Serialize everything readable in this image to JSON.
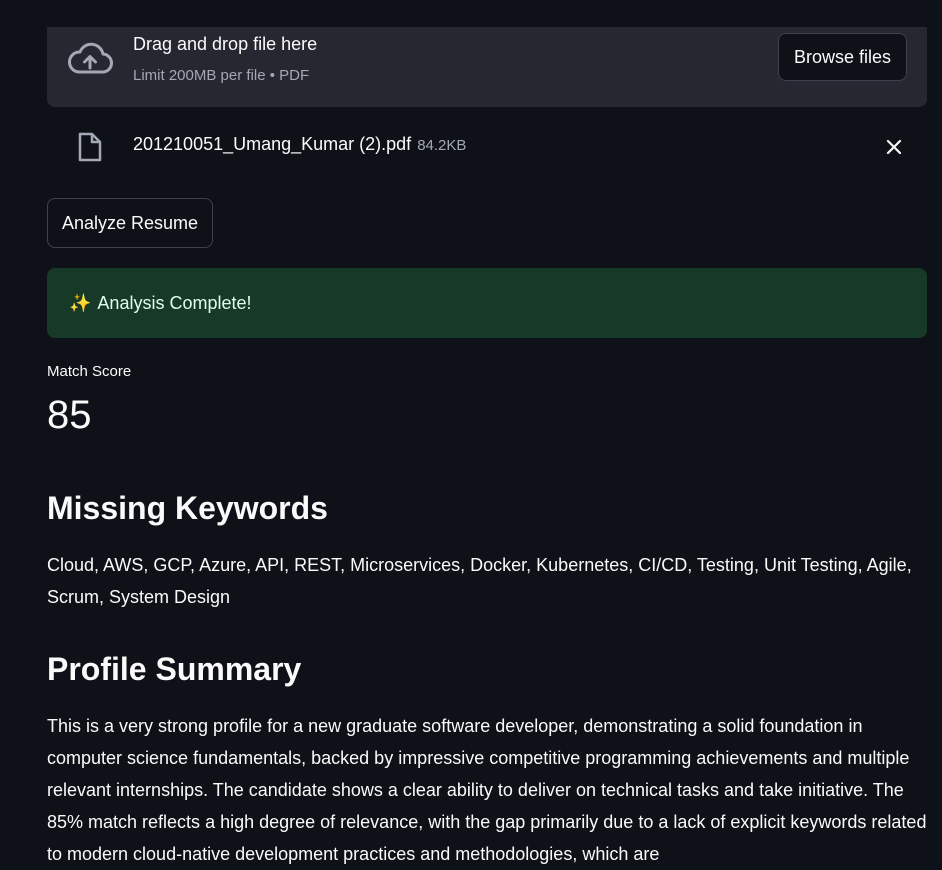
{
  "uploader": {
    "icon": "cloud-upload-icon",
    "title": "Drag and drop file here",
    "subtitle": "Limit 200MB per file • PDF",
    "browse_label": "Browse files"
  },
  "uploaded_file": {
    "icon": "file-icon",
    "name": "201210051_Umang_Kumar (2).pdf",
    "size": "84.2KB",
    "remove_icon": "close-icon"
  },
  "actions": {
    "analyze_label": "Analyze Resume"
  },
  "status": {
    "icon": "sparkles-icon",
    "icon_glyph": "✨",
    "message": "Analysis Complete!",
    "color": "#173928"
  },
  "metric": {
    "label": "Match Score",
    "value": "85"
  },
  "missing_keywords": {
    "heading": "Missing Keywords",
    "text": "Cloud, AWS, GCP, Azure, API, REST, Microservices, Docker, Kubernetes, CI/CD, Testing, Unit Testing, Agile, Scrum, System Design"
  },
  "profile_summary": {
    "heading": "Profile Summary",
    "text": "This is a very strong profile for a new graduate software developer, demonstrating a solid foundation in computer science fundamentals, backed by impressive competitive programming achievements and multiple relevant internships. The candidate shows a clear ability to deliver on technical tasks and take initiative. The 85% match reflects a high degree of relevance, with the gap primarily due to a lack of explicit keywords related to modern cloud-native development practices and methodologies, which are"
  },
  "theme": {
    "background": "#0e1117",
    "surface": "#262730",
    "text": "#fafafa",
    "muted": "#a3a8b4"
  }
}
